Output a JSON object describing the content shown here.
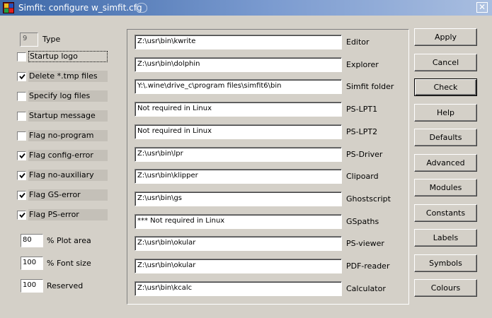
{
  "window": {
    "title": "Simfit: configure w_simfit.cfg",
    "close_symbol": "✕",
    "icon": "simfit-app-icon"
  },
  "left": {
    "type_value": "9",
    "type_label": "Type",
    "checkboxes": [
      {
        "label": "Startup logo",
        "checked": false
      },
      {
        "label": "Delete *.tmp files",
        "checked": true
      },
      {
        "label": "Specify log files",
        "checked": false
      },
      {
        "label": "Startup message",
        "checked": false
      },
      {
        "label": "Flag no-program",
        "checked": false
      },
      {
        "label": "Flag config-error",
        "checked": true
      },
      {
        "label": "Flag no-auxiliary",
        "checked": true
      },
      {
        "label": "Flag GS-error",
        "checked": true
      },
      {
        "label": "Flag PS-error",
        "checked": true
      }
    ],
    "numbers": [
      {
        "value": "80",
        "label": "% Plot area"
      },
      {
        "value": "100",
        "label": "% Font size"
      },
      {
        "value": "100",
        "label": "Reserved"
      }
    ]
  },
  "paths": [
    {
      "value": "Z:\\usr\\bin\\kwrite",
      "label": "Editor"
    },
    {
      "value": "Z:\\usr\\bin\\dolphin",
      "label": "Explorer"
    },
    {
      "value": "Y:\\.wine\\drive_c\\program files\\simfit6\\bin",
      "label": "Simfit folder"
    },
    {
      "value": "Not required in Linux",
      "label": "PS-LPT1"
    },
    {
      "value": "Not required in Linux",
      "label": "PS-LPT2"
    },
    {
      "value": "Z:\\usr\\bin\\lpr",
      "label": "PS-Driver"
    },
    {
      "value": "Z:\\usr\\bin\\klipper",
      "label": "Clipoard"
    },
    {
      "value": "Z:\\usr\\bin\\gs",
      "label": "Ghostscript"
    },
    {
      "value": "*** Not required in Linux",
      "label": "GSpaths"
    },
    {
      "value": "Z:\\usr\\bin\\okular",
      "label": "PS-viewer"
    },
    {
      "value": "Z:\\usr\\bin\\okular",
      "label": "PDF-reader"
    },
    {
      "value": "Z:\\usr\\bin\\kcalc",
      "label": "Calculator"
    }
  ],
  "buttons": [
    "Apply",
    "Cancel",
    "Check",
    "Help",
    "Defaults",
    "Advanced",
    "Modules",
    "Constants",
    "Labels",
    "Symbols",
    "Colours"
  ],
  "colors": {
    "title_start": "#3d68a8",
    "title_end": "#a9bee0",
    "face": "#d4d0c8"
  }
}
